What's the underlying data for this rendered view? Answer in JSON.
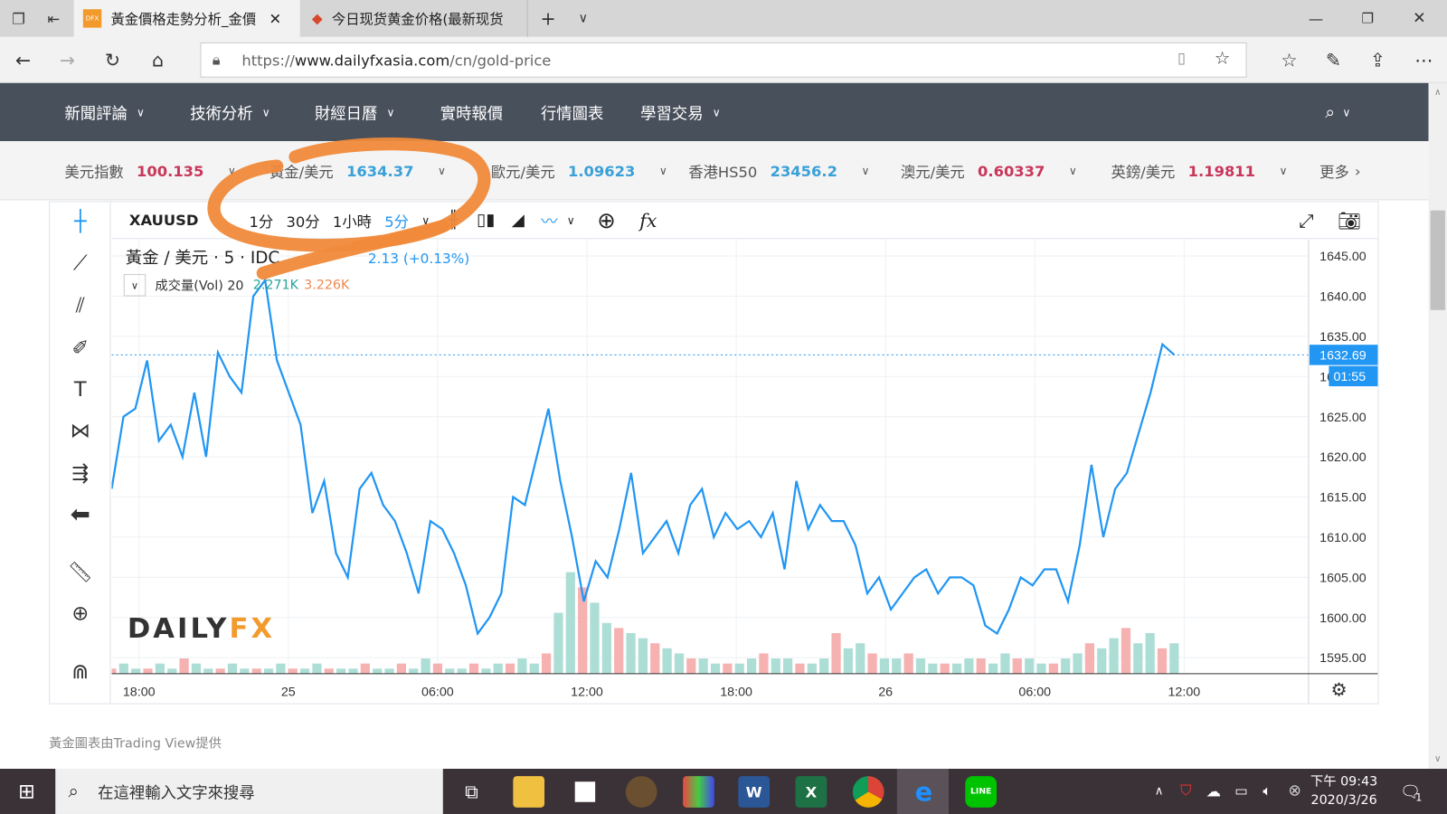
{
  "browser": {
    "tabs": [
      {
        "label": "黃金價格走勢分析_金價",
        "favicon": "DFX",
        "active": true
      },
      {
        "label": "今日现货黄金价格(最新现货",
        "active": false
      }
    ],
    "url_prefix": "https://",
    "url_host": "www.dailyfxasia.com",
    "url_path": "/cn/gold-price"
  },
  "nav": {
    "items": [
      "新聞評論",
      "技術分析",
      "財經日曆",
      "實時報價",
      "行情圖表",
      "學習交易"
    ]
  },
  "ticker": {
    "items": [
      {
        "label": "美元指數",
        "value": "100.135",
        "color": "#c8375a"
      },
      {
        "label": "黃金/美元",
        "value": "1634.37",
        "color": "#3aa0d8"
      },
      {
        "label": "歐元/美元",
        "value": "1.09623",
        "color": "#3aa0d8"
      },
      {
        "label": "香港HS50",
        "value": "23456.2",
        "color": "#3aa0d8"
      },
      {
        "label": "澳元/美元",
        "value": "0.60337",
        "color": "#c8375a"
      },
      {
        "label": "英鎊/美元",
        "value": "1.19811",
        "color": "#c8375a"
      }
    ],
    "more": "更多"
  },
  "chart": {
    "symbol": "XAUUSD",
    "intervals": [
      "1分",
      "30分",
      "1小時",
      "5分"
    ],
    "active_interval": "5分",
    "legend_title": "黃金 / 美元 · 5 · IDC",
    "legend_change": "2.13 (+0.13%)",
    "volume_label": "成交量(Vol) 20",
    "volume_v1": "2.271K",
    "volume_v2": "3.226K",
    "watermark": "DAILYFX",
    "last_price": "1632.69",
    "countdown": "01:55",
    "credit": "黃金圖表由Trading View提供"
  },
  "chart_data": {
    "type": "line",
    "ylim": [
      1593,
      1647
    ],
    "yticks": [
      "1645.00",
      "1640.00",
      "1635.00",
      "1630.00",
      "1625.00",
      "1620.00",
      "1615.00",
      "1610.00",
      "1605.00",
      "1600.00",
      "1595.00"
    ],
    "ytick_values": [
      1645,
      1640,
      1635,
      1630,
      1625,
      1620,
      1615,
      1610,
      1605,
      1600,
      1595
    ],
    "xticks": [
      "18:00",
      "25",
      "06:00",
      "12:00",
      "18:00",
      "26",
      "06:00",
      "12:00"
    ],
    "xtick_hours": [
      0,
      6,
      12,
      18,
      24,
      30,
      36,
      42
    ],
    "x_start_hour": -1.1,
    "x_end_hour": 41.6,
    "x_range": [
      -1.1,
      47.0
    ],
    "series": [
      {
        "name": "黃金 / 美元",
        "color": "#2196f3",
        "values": [
          1616,
          1625,
          1626,
          1632,
          1622,
          1624,
          1620,
          1628,
          1620,
          1633,
          1630,
          1628,
          1640,
          1642,
          1632,
          1628,
          1624,
          1613,
          1617,
          1608,
          1605,
          1616,
          1618,
          1614,
          1612,
          1608,
          1603,
          1612,
          1611,
          1608,
          1604,
          1598,
          1600,
          1603,
          1615,
          1614,
          1620,
          1626,
          1617,
          1610,
          1602,
          1607,
          1605,
          1611,
          1618,
          1608,
          1610,
          1612,
          1608,
          1614,
          1616,
          1610,
          1613,
          1611,
          1612,
          1610,
          1613,
          1606,
          1617,
          1611,
          1614,
          1612,
          1612,
          1609,
          1603,
          1605,
          1601,
          1603,
          1605,
          1606,
          1603,
          1605,
          1605,
          1604,
          1599,
          1598,
          1601,
          1605,
          1604,
          1606,
          1606,
          1602,
          1609,
          1619,
          1610,
          1616,
          1618,
          1623,
          1628,
          1634,
          1632.69
        ]
      }
    ],
    "volume": [
      1,
      2,
      1,
      1,
      2,
      1,
      3,
      2,
      1,
      1,
      2,
      1,
      1,
      1,
      2,
      1,
      1,
      2,
      1,
      1,
      1,
      2,
      1,
      1,
      2,
      1,
      3,
      2,
      1,
      1,
      2,
      1,
      2,
      2,
      3,
      2,
      4,
      12,
      20,
      17,
      14,
      10,
      9,
      8,
      7,
      6,
      5,
      4,
      3,
      3,
      2,
      2,
      2,
      3,
      4,
      3,
      3,
      2,
      2,
      3,
      8,
      5,
      6,
      4,
      3,
      3,
      4,
      3,
      2,
      2,
      2,
      3,
      3,
      2,
      4,
      3,
      3,
      2,
      2,
      3,
      4,
      6,
      5,
      7,
      9,
      6,
      8,
      5,
      6
    ]
  },
  "taskbar": {
    "search_placeholder": "在這裡輸入文字來搜尋",
    "time": "下午 09:43",
    "date": "2020/3/26",
    "notifications": "1"
  }
}
